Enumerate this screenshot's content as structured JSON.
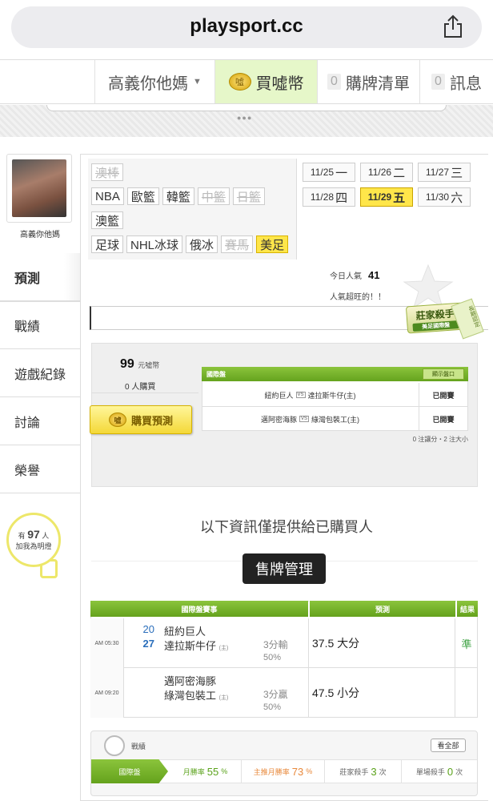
{
  "browser": {
    "url": "playsport.cc"
  },
  "userbar": {
    "username": "高義你他媽",
    "buy_coins": "買噓幣",
    "cart_count": "0",
    "cart_label": "購牌清單",
    "msg_count": "0",
    "msg_label": "訊息",
    "coin_glyph": "噓"
  },
  "sidebar": {
    "avatar_name": "高義你他媽",
    "items": [
      "預測",
      "戰績",
      "遊戲紀錄",
      "討論",
      "榮譽"
    ],
    "fans_prefix": "有",
    "fans_count": "97",
    "fans_suffix": "人",
    "fans_label": "加我為明燈"
  },
  "categories": {
    "row1": [
      {
        "label": "澳棒",
        "disabled": true
      }
    ],
    "row2": [
      {
        "label": "NBA"
      },
      {
        "label": "歐籃"
      },
      {
        "label": "韓籃"
      },
      {
        "label": "中籃",
        "disabled": true
      },
      {
        "label": "日籃",
        "disabled": true
      }
    ],
    "row3": [
      {
        "label": "澳籃"
      }
    ],
    "row4": [
      {
        "label": "足球"
      },
      {
        "label": "NHL冰球"
      },
      {
        "label": "俄冰"
      },
      {
        "label": "賽馬",
        "disabled": true
      },
      {
        "label": "美足",
        "active": true
      }
    ]
  },
  "dates": [
    {
      "d": "11/25",
      "w": "一"
    },
    {
      "d": "11/26",
      "w": "二"
    },
    {
      "d": "11/27",
      "w": "三"
    },
    {
      "d": "11/28",
      "w": "四"
    },
    {
      "d": "11/29",
      "w": "五",
      "active": true
    },
    {
      "d": "11/30",
      "w": "六"
    }
  ],
  "popularity": {
    "label": "今日人氣",
    "value": "41",
    "note": "人氣超旺的！！"
  },
  "badge": {
    "title": "莊家殺手",
    "sub": "美足國際盤",
    "ribbon": "長期認定"
  },
  "buy": {
    "price": "99",
    "unit": "元噓幣",
    "buyers": "0 人購買",
    "button": "購買預測",
    "table_title": "國際盤",
    "show_button": "顯示盤口",
    "rows": [
      {
        "away": "紐約巨人",
        "vs": "VS",
        "home": "達拉斯牛仔(主)",
        "status": "已開賽"
      },
      {
        "away": "邁阿密海豚",
        "vs": "VS",
        "home": "綠灣包裝工(主)",
        "status": "已開賽"
      }
    ],
    "note": "0 注讓分・2 注大小"
  },
  "info": {
    "text": "以下資訊僅提供給已購買人",
    "sale_button": "售牌管理"
  },
  "games": {
    "headers": {
      "event": "國際盤賽事",
      "pred": "預測",
      "result": "結果"
    },
    "rows": [
      {
        "time": "AM 05:30",
        "s1": "20",
        "s2": "27",
        "t1": "紐約巨人",
        "t2": "達拉斯牛仔",
        "home": "(主)",
        "line": "3分輸",
        "pct": "50%",
        "pred": "37.5 大分",
        "result": "準"
      },
      {
        "time": "AM 09:20",
        "s1": "",
        "s2": "",
        "t1": "邁阿密海豚",
        "t2": "綠灣包裝工",
        "home": "(主)",
        "line": "3分贏",
        "pct": "50%",
        "pred": "47.5 小分",
        "result": ""
      }
    ]
  },
  "record": {
    "title": "戰績",
    "all": "看全部",
    "tab": "國際盤",
    "stats": [
      {
        "label": "月勝率",
        "value": "55",
        "unit": "%",
        "color": "#5aa21a"
      },
      {
        "label": "主推月勝率",
        "value": "73",
        "unit": "%",
        "color": "#e8883a"
      },
      {
        "label": "莊家殺手",
        "value": "3",
        "unit": "次",
        "color": "#5aa21a"
      },
      {
        "label": "單場殺手",
        "value": "0",
        "unit": "次",
        "color": "#5aa21a"
      }
    ]
  }
}
